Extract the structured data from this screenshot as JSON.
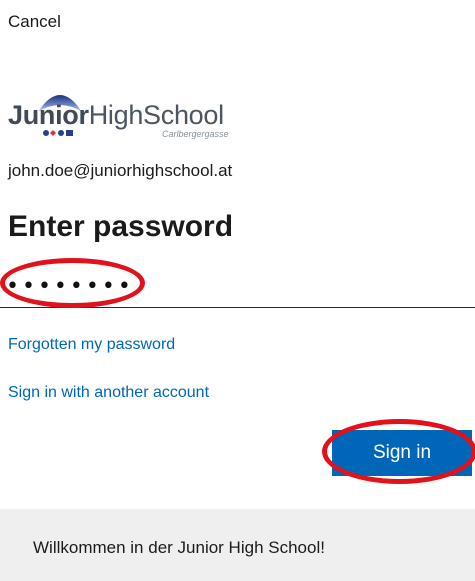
{
  "header": {
    "cancel_label": "Cancel"
  },
  "logo": {
    "brand_bold": "Junior",
    "brand_light": "HighSchool",
    "sub": "Carlbergergasse"
  },
  "account": {
    "email": "john.doe@juniorhighschool.at"
  },
  "form": {
    "title": "Enter password",
    "password_mask": "••••••••",
    "forgot_label": "Forgotten my password",
    "other_account_label": "Sign in with another account",
    "signin_label": "Sign in"
  },
  "banner": {
    "text": "Willkommen in der Junior High School!"
  },
  "colors": {
    "accent": "#0067b8",
    "annotation": "#e1121b",
    "banner_bg": "#efefef"
  }
}
